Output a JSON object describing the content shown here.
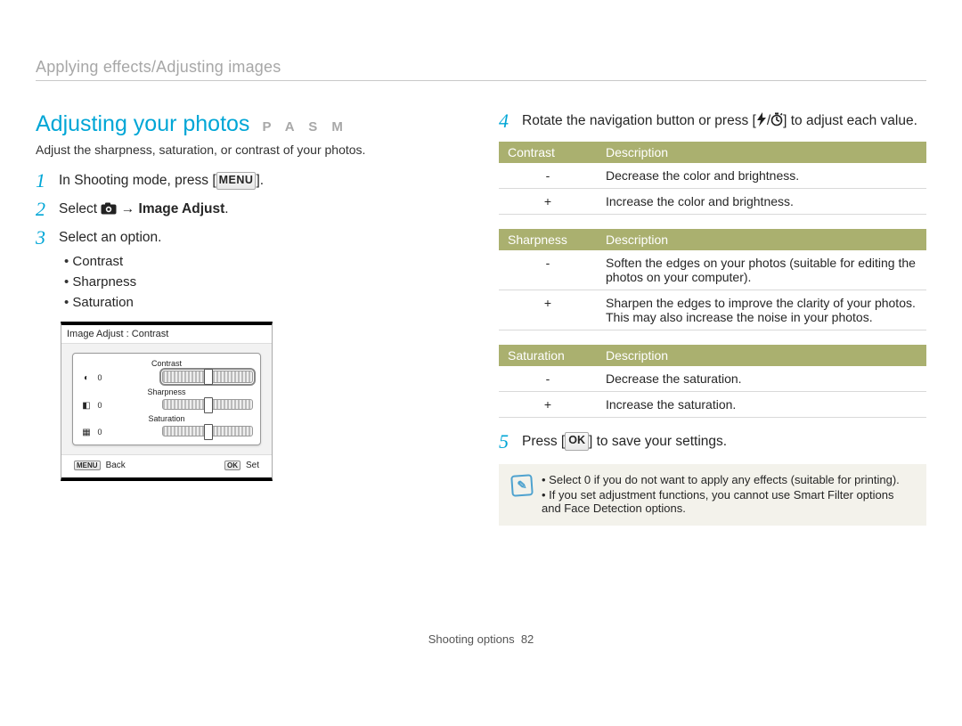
{
  "breadcrumb": "Applying effects/Adjusting images",
  "title": "Adjusting your photos",
  "modes": "P A S M",
  "subtitle": "Adjust the sharpness, saturation, or contrast of your photos.",
  "step1": {
    "pre": "In Shooting mode, press [",
    "btn": "MENU",
    "post": "]."
  },
  "step2": {
    "pre": "Select ",
    "mid": " → ",
    "bold": "Image Adjust",
    "post": "."
  },
  "step3": {
    "text": "Select an option.",
    "bullets": [
      "Contrast",
      "Sharpness",
      "Saturation"
    ]
  },
  "camscreen": {
    "header": "Image Adjust : Contrast",
    "rows": [
      {
        "icon": "◐",
        "zero": "0",
        "label": "Contrast",
        "highlight": true
      },
      {
        "icon": "◧",
        "zero": "0",
        "label": "Sharpness",
        "highlight": false
      },
      {
        "icon": "▦",
        "zero": "0",
        "label": "Saturation",
        "highlight": false
      }
    ],
    "back_btn": "MENU",
    "back_lbl": "Back",
    "set_btn": "OK",
    "set_lbl": "Set"
  },
  "step4": {
    "pre": "Rotate the navigation button or press [",
    "sep": "/",
    "post": "] to adjust each value."
  },
  "tables": {
    "contrast": {
      "head": [
        "Contrast",
        "Description"
      ],
      "rows": [
        [
          "-",
          "Decrease the color and brightness."
        ],
        [
          "+",
          "Increase the color and brightness."
        ]
      ]
    },
    "sharpness": {
      "head": [
        "Sharpness",
        "Description"
      ],
      "rows": [
        [
          "-",
          "Soften the edges on your photos (suitable for editing the photos on your computer)."
        ],
        [
          "+",
          "Sharpen the edges to improve the clarity of your photos. This may also increase the noise in your photos."
        ]
      ]
    },
    "saturation": {
      "head": [
        "Saturation",
        "Description"
      ],
      "rows": [
        [
          "-",
          "Decrease the saturation."
        ],
        [
          "+",
          "Increase the saturation."
        ]
      ]
    }
  },
  "step5": {
    "pre": "Press [",
    "btn": "OK",
    "post": "] to save your settings."
  },
  "notes": [
    "Select 0 if you do not want to apply any effects (suitable for printing).",
    "If you set adjustment functions, you cannot use Smart Filter options and Face Detection options."
  ],
  "footer": {
    "section": "Shooting options",
    "page": "82"
  }
}
